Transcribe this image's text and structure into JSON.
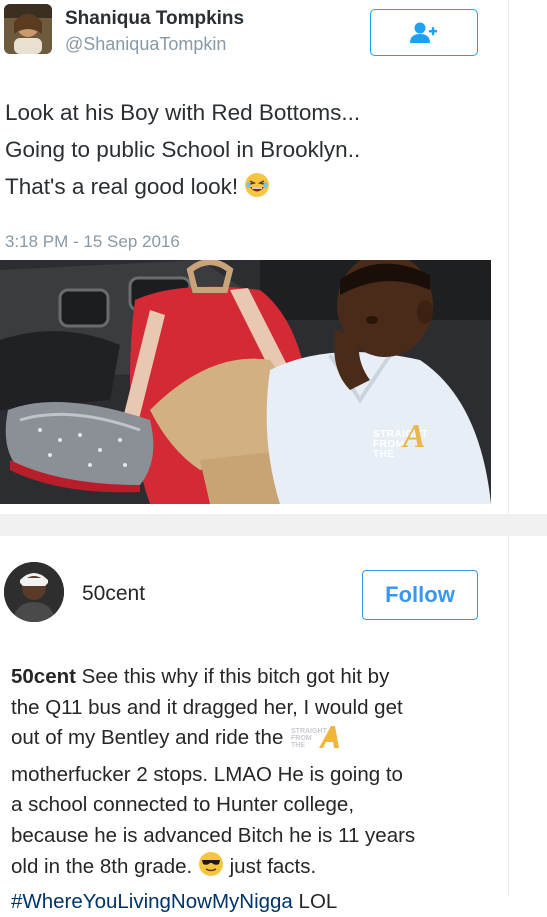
{
  "tweet_card": {
    "display_name": "Shaniqua Tompkins",
    "handle": "@ShaniquaTompkin",
    "text_lines": [
      "Look at his Boy with Red Bottoms...",
      "Going to public School in Brooklyn..",
      "That's a real good look!"
    ],
    "timestamp": "3:18 PM - 15 Sep 2016",
    "follow_icon": "add-user-icon",
    "photo_watermark": {
      "line1": "STRAIGHT",
      "line2": "FROM",
      "line3": "THE",
      "letter": "A"
    }
  },
  "insta_card": {
    "username": "50cent",
    "follow_label": "Follow",
    "caption_user": "50cent",
    "caption_lines": [
      " See this why if this bitch got hit by",
      "the Q11 bus and it dragged her, I would get",
      "out of my Bentley and ride the",
      "motherfucker 2 stops. LMAO He is going to",
      "a school connected to Hunter college,",
      "because he is advanced Bitch he is 11 years",
      "old in the 8th grade.",
      " just facts."
    ],
    "hashtag": "#WhereYouLivingNowMyNigga",
    "hashtag_tail": " LOL"
  },
  "colors": {
    "twitter_blue": "#1da1f2",
    "instagram_blue": "#3897f0",
    "hashtag": "#003569",
    "muted": "#8899a6"
  }
}
